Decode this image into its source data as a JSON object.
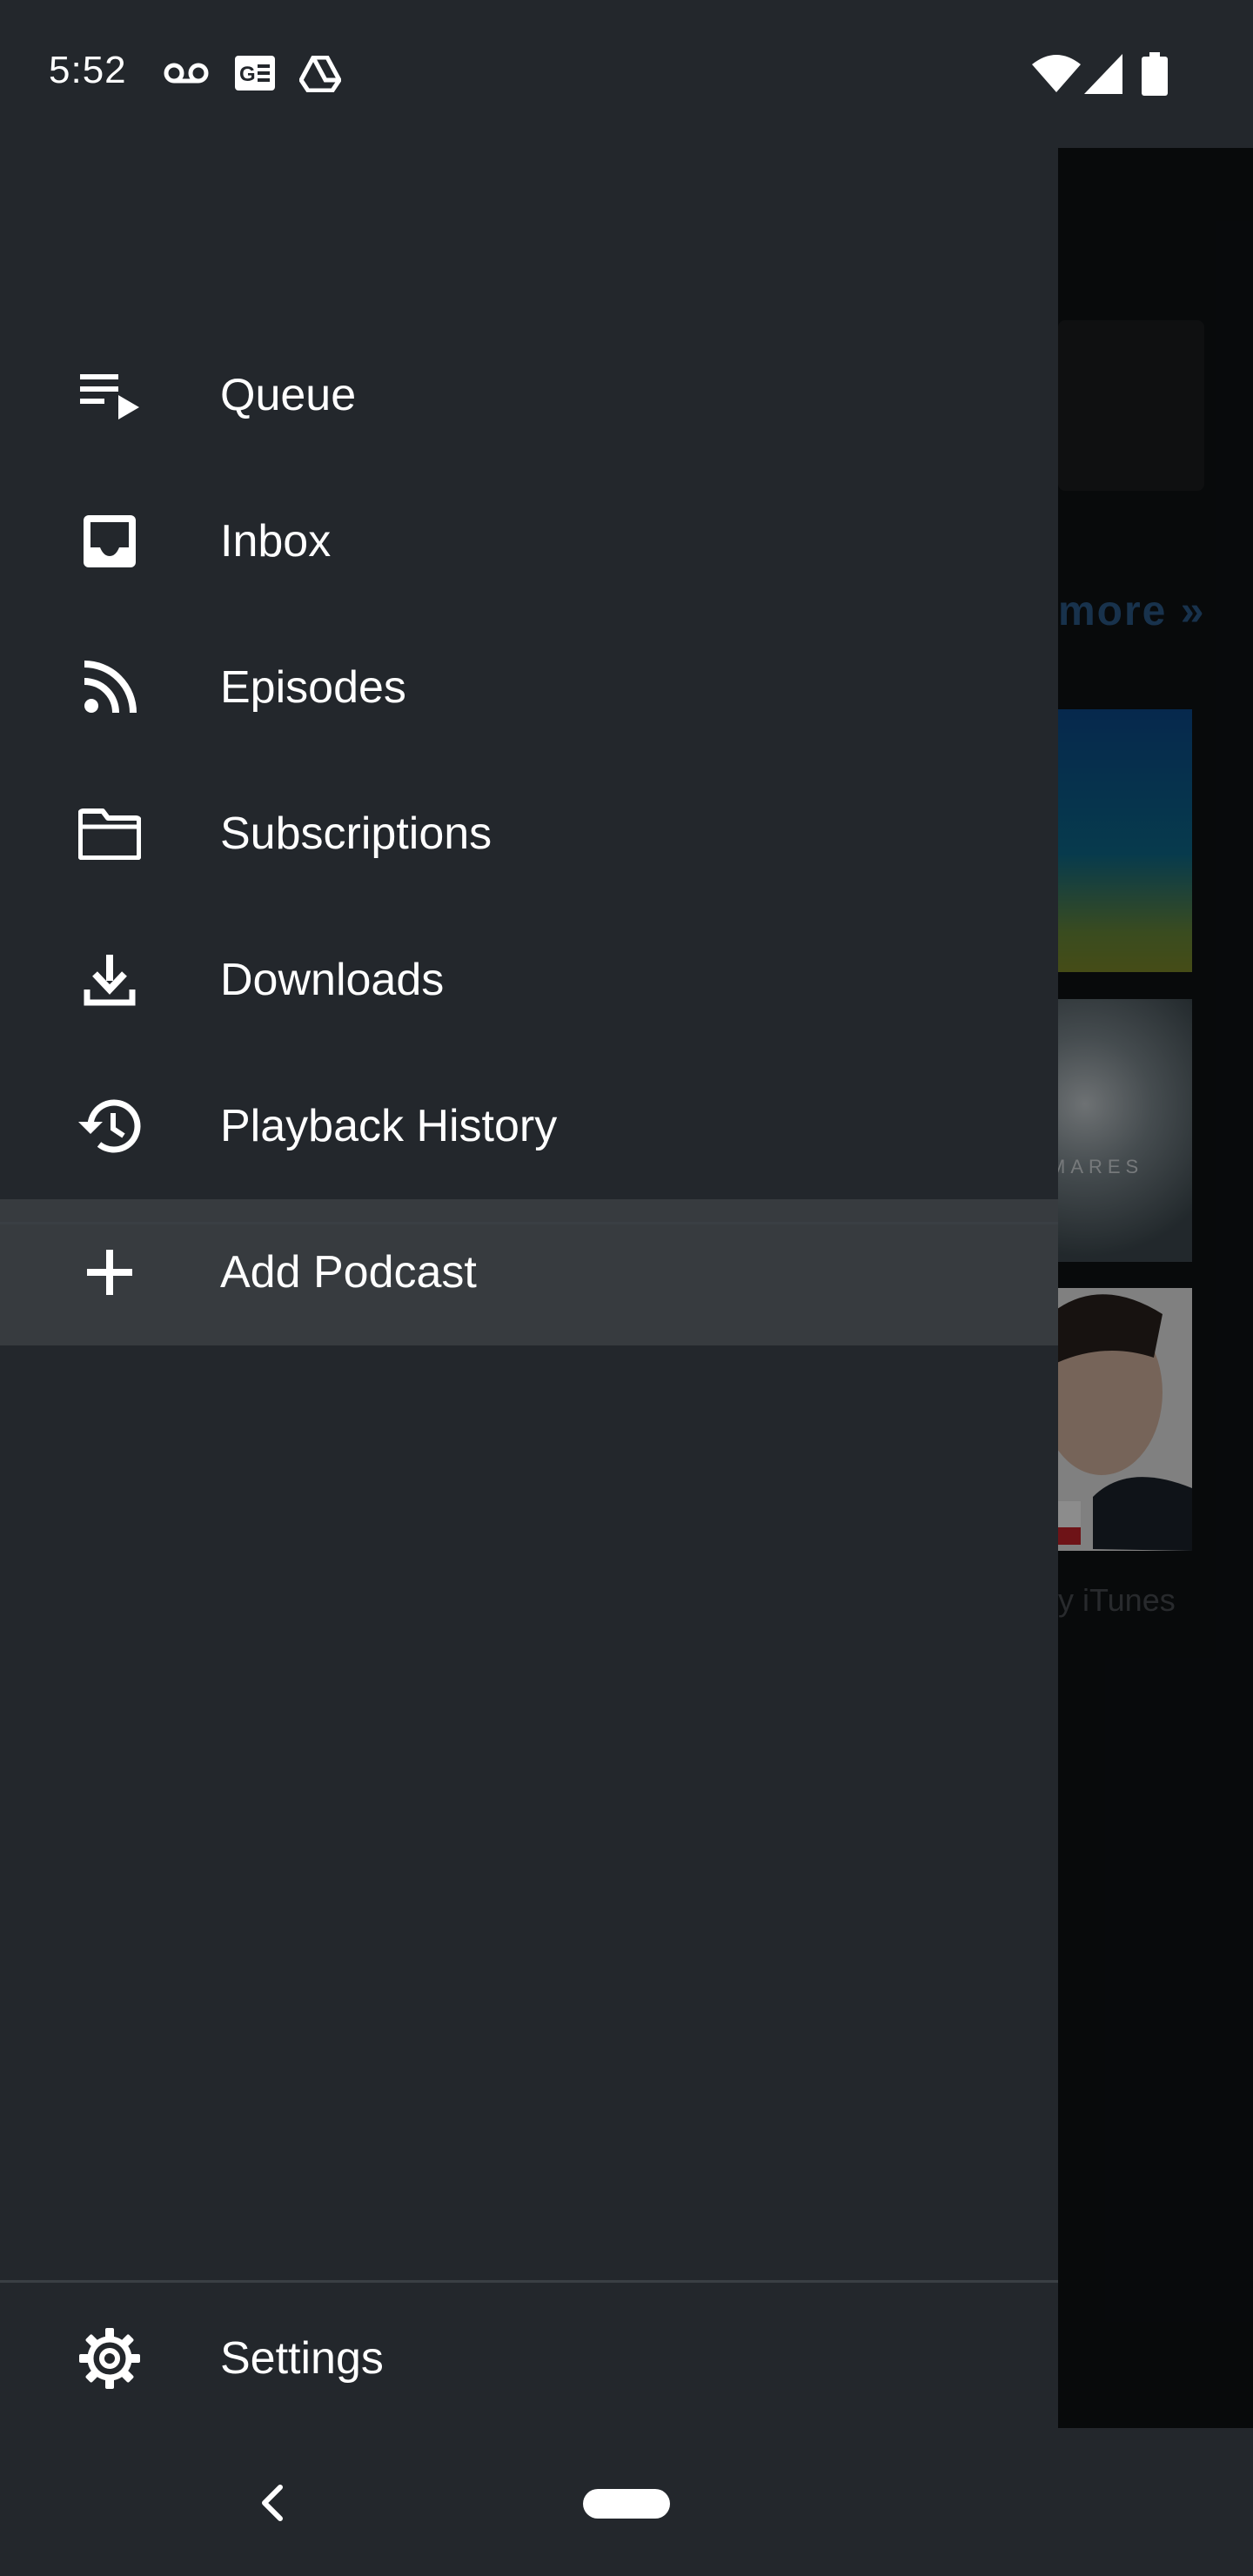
{
  "status_bar": {
    "time": "5:52",
    "left_icons": [
      "voicemail-icon",
      "news-icon",
      "drive-icon"
    ],
    "right_icons": [
      "wifi-icon",
      "signal-icon",
      "battery-icon"
    ]
  },
  "background_app": {
    "more_link": "more »",
    "art_text": "MARES",
    "attribution": "y iTunes"
  },
  "drawer": {
    "items": [
      {
        "label": "Queue",
        "icon": "queue-icon"
      },
      {
        "label": "Inbox",
        "icon": "inbox-icon"
      },
      {
        "label": "Episodes",
        "icon": "rss-icon"
      },
      {
        "label": "Subscriptions",
        "icon": "folder-icon"
      },
      {
        "label": "Downloads",
        "icon": "download-icon"
      },
      {
        "label": "Playback History",
        "icon": "history-icon"
      },
      {
        "label": "Add Podcast",
        "icon": "plus-icon",
        "selected": true
      }
    ],
    "footer": {
      "label": "Settings",
      "icon": "gear-icon"
    }
  },
  "nav_bar": {
    "back": "back-icon",
    "home": "home-pill-icon"
  }
}
